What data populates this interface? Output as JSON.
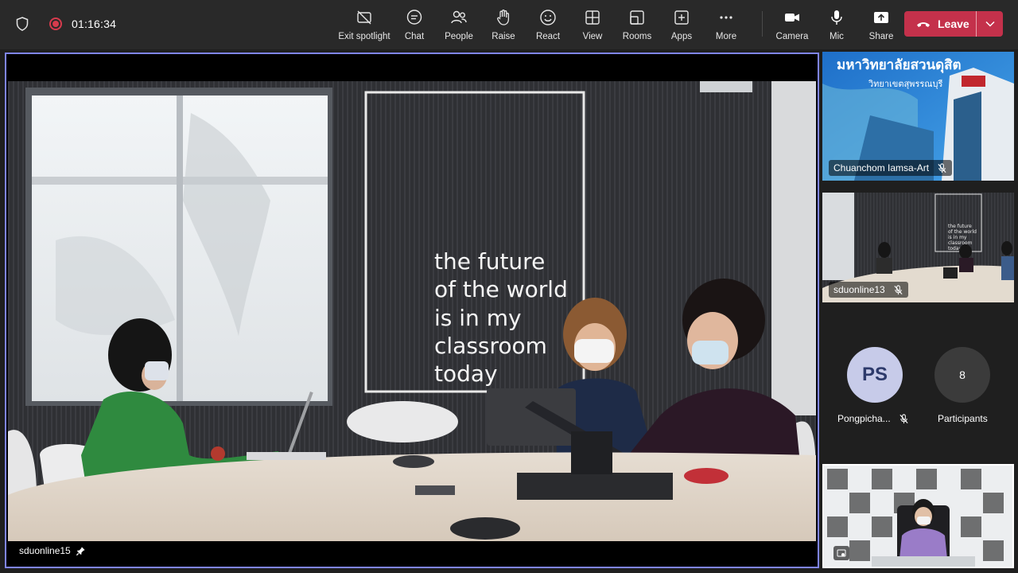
{
  "meeting": {
    "timer": "01:16:34"
  },
  "toolbar": {
    "items": [
      {
        "label": "Exit spotlight",
        "icon": "exit-spotlight-icon"
      },
      {
        "label": "Chat",
        "icon": "chat-icon"
      },
      {
        "label": "People",
        "icon": "people-icon"
      },
      {
        "label": "Raise",
        "icon": "raise-hand-icon"
      },
      {
        "label": "React",
        "icon": "react-icon"
      },
      {
        "label": "View",
        "icon": "view-grid-icon"
      },
      {
        "label": "Rooms",
        "icon": "rooms-icon"
      },
      {
        "label": "Apps",
        "icon": "apps-icon"
      },
      {
        "label": "More",
        "icon": "more-icon"
      }
    ],
    "devices": [
      {
        "label": "Camera",
        "icon": "camera-icon"
      },
      {
        "label": "Mic",
        "icon": "mic-icon"
      },
      {
        "label": "Share",
        "icon": "share-icon"
      }
    ],
    "leave_label": "Leave",
    "leave_color": "#c4314b"
  },
  "stage": {
    "participant": "sduonline15",
    "pinned": true,
    "wall_text": [
      "the future",
      "of the world",
      "is in my",
      "classroom",
      "today"
    ],
    "accent": "#7f85f5"
  },
  "rail": {
    "tile1": {
      "name": "Chuanchom Iamsa-Art",
      "muted": true,
      "sign_line1": "มหาวิทยาลัยสวนดุสิต",
      "sign_line2": "วิทยาเขตสุพรรณบุรี"
    },
    "tile2": {
      "name": "sduonline13",
      "muted": true,
      "wall_text": [
        "the future",
        "of the world",
        "is in my",
        "classroom",
        "today"
      ]
    },
    "avatar": {
      "initials": "PS",
      "name": "Pongpicha...",
      "muted": true
    },
    "participants": {
      "count": "8",
      "label": "Participants"
    }
  }
}
